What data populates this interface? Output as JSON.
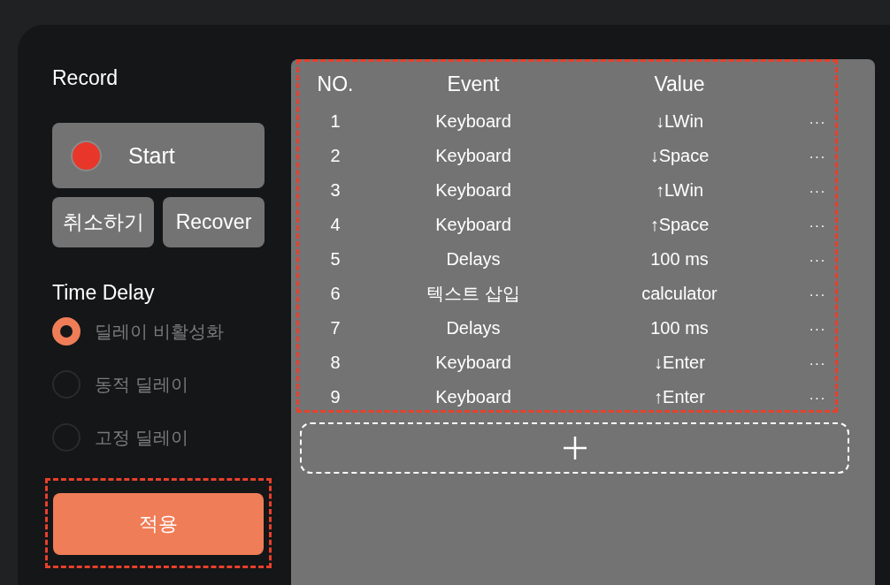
{
  "record": {
    "title": "Record",
    "start_button": "Start",
    "cancel_button": "취소하기",
    "recover_button": "Recover"
  },
  "time_delay": {
    "title": "Time Delay",
    "options": [
      {
        "label": "딜레이 비활성화",
        "selected": true
      },
      {
        "label": "동적 딜레이",
        "selected": false
      },
      {
        "label": "고정 딜레이",
        "selected": false
      }
    ]
  },
  "apply_button": {
    "label": "적용",
    "highlighted": true
  },
  "table": {
    "highlighted": true,
    "columns": [
      "NO.",
      "Event",
      "Value"
    ],
    "rows": [
      {
        "no": "1",
        "event": "Keyboard",
        "value": "↓LWin",
        "menu": "···"
      },
      {
        "no": "2",
        "event": "Keyboard",
        "value": "↓Space",
        "menu": "···"
      },
      {
        "no": "3",
        "event": "Keyboard",
        "value": "↑LWin",
        "menu": "···"
      },
      {
        "no": "4",
        "event": "Keyboard",
        "value": "↑Space",
        "menu": "···"
      },
      {
        "no": "5",
        "event": "Delays",
        "value": "100 ms",
        "menu": "···"
      },
      {
        "no": "6",
        "event": "텍스트 삽입",
        "value": "calculator",
        "menu": "···"
      },
      {
        "no": "7",
        "event": "Delays",
        "value": "100 ms",
        "menu": "···"
      },
      {
        "no": "8",
        "event": "Keyboard",
        "value": "↓Enter",
        "menu": "···"
      },
      {
        "no": "9",
        "event": "Keyboard",
        "value": "↑Enter",
        "menu": "···"
      }
    ]
  }
}
